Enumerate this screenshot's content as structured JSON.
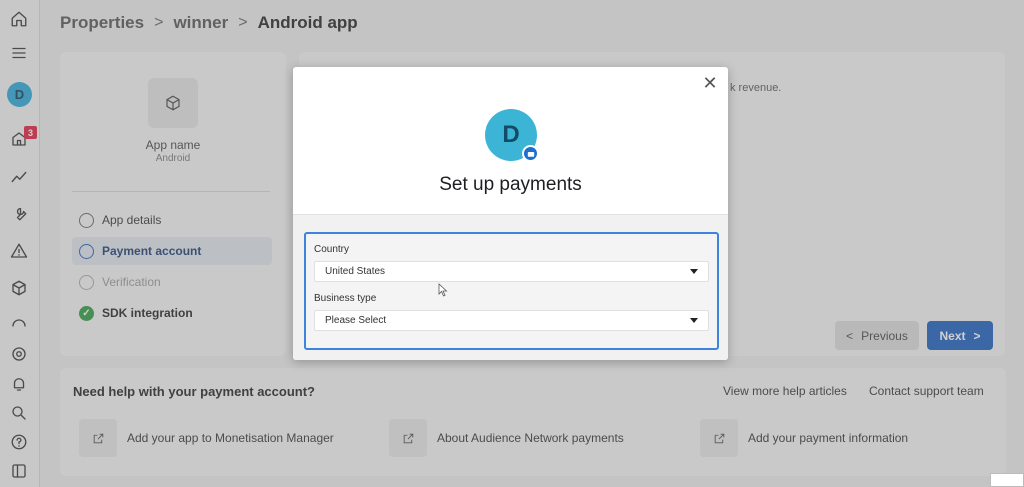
{
  "breadcrumb": {
    "item1": "Properties",
    "item2": "winner",
    "current": "Android app"
  },
  "rail": {
    "avatar_letter": "D",
    "notification_count": "3"
  },
  "app_card": {
    "name": "App name",
    "platform": "Android"
  },
  "steps": [
    {
      "label": "App details",
      "state": "default"
    },
    {
      "label": "Payment account",
      "state": "active"
    },
    {
      "label": "Verification",
      "state": "disabled"
    },
    {
      "label": "SDK integration",
      "state": "done"
    }
  ],
  "right_panel": {
    "partial_text": "k revenue."
  },
  "nav_buttons": {
    "previous": "Previous",
    "next": "Next"
  },
  "help": {
    "title": "Need help with your payment account?",
    "more_articles": "View more help articles",
    "contact_support": "Contact support team",
    "items": [
      "Add your app to Monetisation Manager",
      "About Audience Network payments",
      "Add your payment information"
    ]
  },
  "modal": {
    "avatar_letter": "D",
    "title": "Set up payments",
    "country_label": "Country",
    "country_value": "United States",
    "business_type_label": "Business type",
    "business_type_value": "Please Select"
  },
  "colors": {
    "primary": "#1b5fc1",
    "avatar": "#3bb4d6",
    "success": "#2a9d3e",
    "badge": "#e41e3f"
  }
}
